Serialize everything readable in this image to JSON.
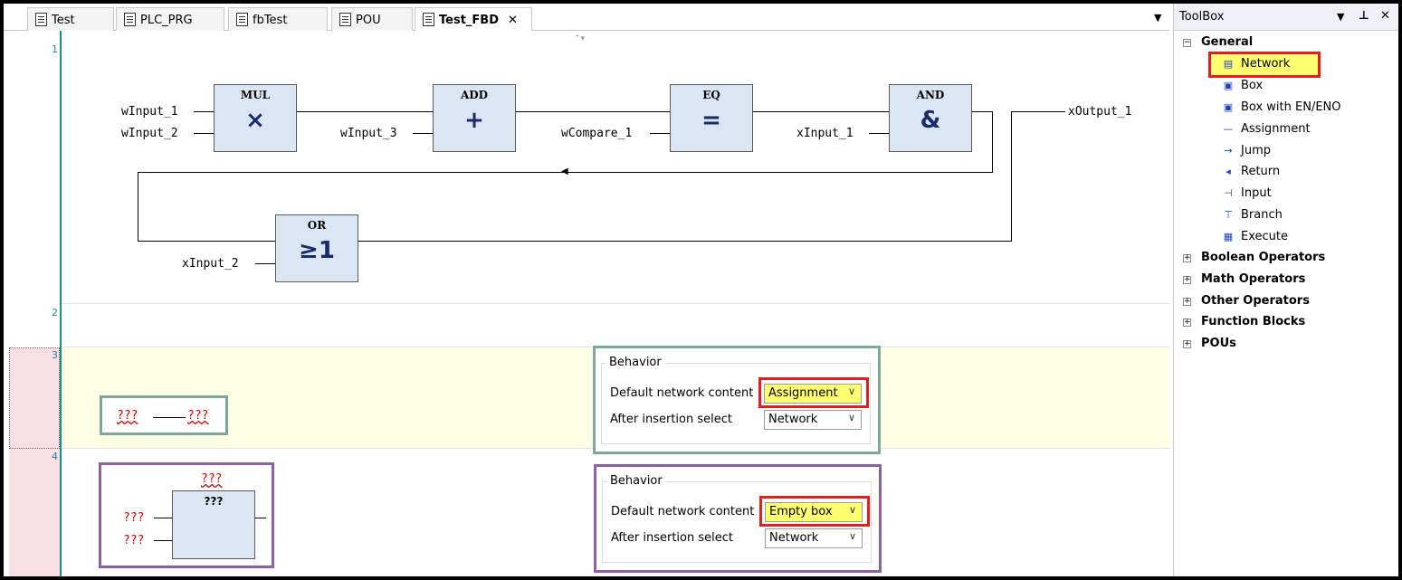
{
  "tabs": [
    {
      "label": "Test"
    },
    {
      "label": "PLC_PRG"
    },
    {
      "label": "fbTest"
    },
    {
      "label": "POU"
    },
    {
      "label": "Test_FBD",
      "close": "✕"
    }
  ],
  "tab_dropdown": "▼",
  "networks": [
    {
      "num": "1"
    },
    {
      "num": "2"
    },
    {
      "num": "3"
    },
    {
      "num": "4"
    }
  ],
  "fbd": {
    "mul": {
      "title": "MUL",
      "symbol": "×"
    },
    "add": {
      "title": "ADD",
      "symbol": "+"
    },
    "eq": {
      "title": "EQ",
      "symbol": "="
    },
    "and": {
      "title": "AND",
      "symbol": "&"
    },
    "or": {
      "title": "OR",
      "symbol": "≥1"
    },
    "vars": {
      "winput1": "wInput_1",
      "winput2": "wInput_2",
      "winput3": "wInput_3",
      "wcompare1": "wCompare_1",
      "xinput1": "xInput_1",
      "xoutput1": "xOutput_1",
      "xinput2": "xInput_2"
    }
  },
  "net3": {
    "left": "???",
    "right": "???"
  },
  "net4": {
    "top": "???",
    "box_title": "???",
    "in1": "???",
    "in2": "???"
  },
  "behavior1": {
    "group": "Behavior",
    "content_label": "Default network content",
    "content_value": "Assignment",
    "select_label": "After insertion select",
    "select_value": "Network"
  },
  "behavior2": {
    "group": "Behavior",
    "content_label": "Default network content",
    "content_value": "Empty box",
    "select_label": "After insertion select",
    "select_value": "Network"
  },
  "toolbox": {
    "title": "ToolBox",
    "header_icons": {
      "dropdown": "▼",
      "pin": "⊥",
      "close": "✕"
    },
    "general": {
      "label": "General",
      "expander": "−"
    },
    "items": [
      {
        "label": "Network",
        "icon": "▤"
      },
      {
        "label": "Box",
        "icon": "▣"
      },
      {
        "label": "Box with EN/ENO",
        "icon": "▣"
      },
      {
        "label": "Assignment",
        "icon": "—"
      },
      {
        "label": "Jump",
        "icon": "→"
      },
      {
        "label": "Return",
        "icon": "◂"
      },
      {
        "label": "Input",
        "icon": "⊣"
      },
      {
        "label": "Branch",
        "icon": "⊤"
      },
      {
        "label": "Execute",
        "icon": "▦"
      }
    ],
    "categories": [
      {
        "label": "Boolean Operators"
      },
      {
        "label": "Math Operators"
      },
      {
        "label": "Other Operators"
      },
      {
        "label": "Function Blocks"
      },
      {
        "label": "POUs"
      }
    ],
    "expander": "+"
  },
  "colors": {
    "net3_bg": "#ffffe6",
    "gutter_pink": "#f6e0e4",
    "highlight_yellow": "#ffff70",
    "red_frame": "#e02020",
    "green_frame": "#7ea89a",
    "purple_frame": "#8e60a8",
    "fbd_block": "#dbe6f4"
  }
}
